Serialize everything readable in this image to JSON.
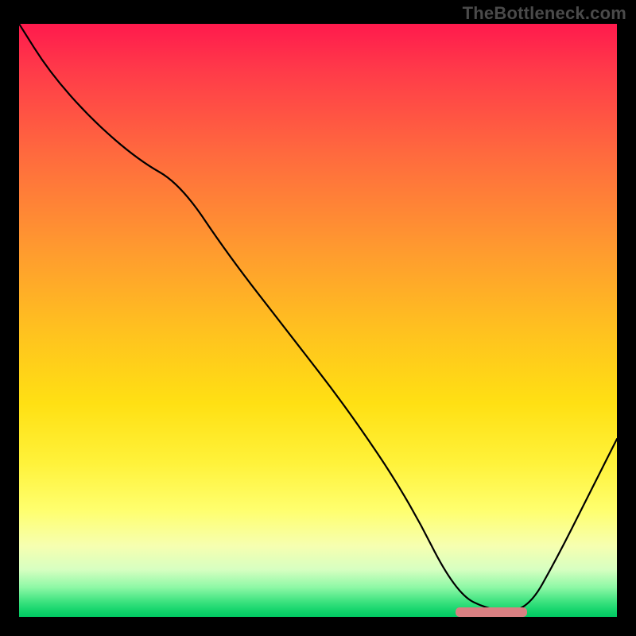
{
  "watermark": "TheBottleneck.com",
  "colors": {
    "frame_bg": "#000000",
    "marker": "#d98082",
    "curve": "#000000"
  },
  "chart_data": {
    "type": "line",
    "title": "",
    "xlabel": "",
    "ylabel": "",
    "xlim": [
      0,
      100
    ],
    "ylim": [
      0,
      100
    ],
    "grid": false,
    "marker_range": [
      73,
      85
    ],
    "x": [
      0,
      5,
      12,
      20,
      27,
      35,
      45,
      55,
      65,
      73,
      79,
      85,
      90,
      95,
      100
    ],
    "values": [
      100,
      92,
      84,
      77,
      73,
      61,
      48,
      35,
      20,
      4,
      1,
      1,
      10,
      20,
      30
    ],
    "note": "x and values are percent of the plotting area; values are the curve height read off the vertical gradient axis (0 = bottom/green, 100 = top/red). Values are estimated from pixel positions since the original image has no axis ticks."
  }
}
